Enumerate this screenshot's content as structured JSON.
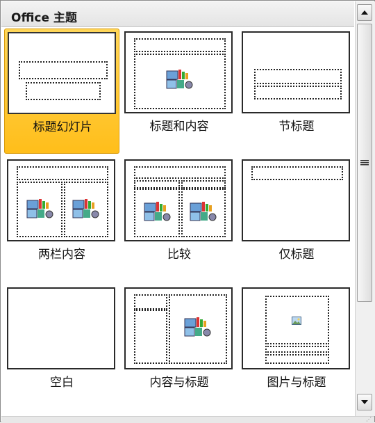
{
  "header": {
    "title": "Office 主题"
  },
  "layouts": [
    {
      "label": "标题幻灯片",
      "selected": true
    },
    {
      "label": "标题和内容",
      "selected": false
    },
    {
      "label": "节标题",
      "selected": false
    },
    {
      "label": "两栏内容",
      "selected": false
    },
    {
      "label": "比较",
      "selected": false
    },
    {
      "label": "仅标题",
      "selected": false
    },
    {
      "label": "空白",
      "selected": false
    },
    {
      "label": "内容与标题",
      "selected": false
    },
    {
      "label": "图片与标题",
      "selected": false
    }
  ],
  "scrollbar": {
    "up_icon": "up-arrow-icon",
    "down_icon": "down-arrow-icon",
    "thumb_icon": "grip-lines-icon"
  },
  "colors": {
    "selected_fill": "#ffc930",
    "selected_border": "#d89a0a"
  }
}
